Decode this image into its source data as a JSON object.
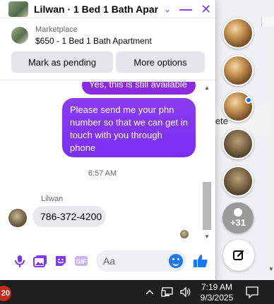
{
  "chat": {
    "title": "Lilwan · 1 Bed 1 Bath Apart…",
    "marketplace_label": "Marketplace",
    "listing": "$650 - 1 Bed 1 Bath Apartment",
    "btn_pending": "Mark as pending",
    "btn_more": "More options",
    "messages": {
      "out1": "Yes, this is still available",
      "out2": "Please send me your phn number so that we can get in touch with you through phone",
      "time": "6:57 AM",
      "sender": "Lilwan",
      "in1": "786-372-4200"
    },
    "composer_placeholder": "Aa"
  },
  "side": {
    "stub_text": "lete",
    "more_count": "+31"
  },
  "taskbar": {
    "badge": "20",
    "time": "7:19 AM",
    "date": "9/3/2025"
  },
  "colors": {
    "accent": "#7c3aed",
    "bubble_out": "#8a2be2",
    "blue": "#1877f2"
  }
}
